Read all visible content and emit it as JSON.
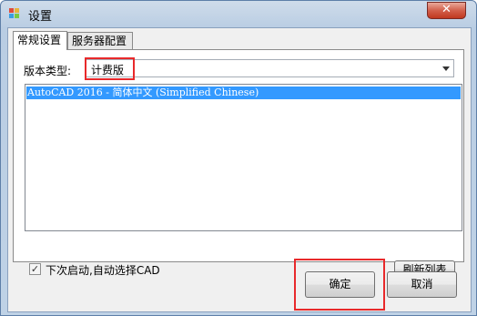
{
  "window": {
    "title": "设置",
    "close_label": "✕"
  },
  "tabs": [
    {
      "label": "常规设置",
      "active": true
    },
    {
      "label": "服务器配置",
      "active": false
    }
  ],
  "general": {
    "version_type_label": "版本类型:",
    "version_type_value": "计费版",
    "list_items": [
      "AutoCAD 2016 - 简体中文 (Simplified Chinese)"
    ],
    "auto_select_checked": true,
    "auto_select_label": "下次启动,自动选择CAD",
    "refresh_label": "刷新列表"
  },
  "buttons": {
    "ok_label": "确定",
    "cancel_label": "取消"
  },
  "colors": {
    "highlight_box": "#e8292b",
    "selection": "#3399ff"
  }
}
